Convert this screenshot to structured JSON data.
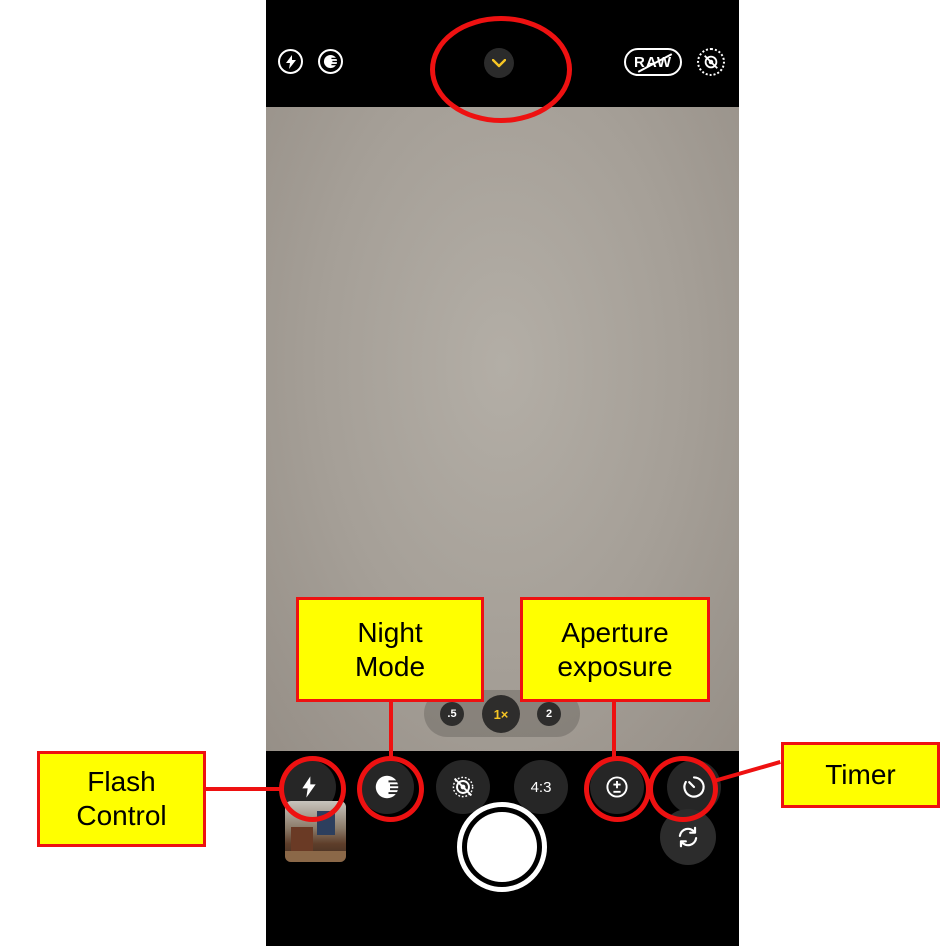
{
  "camera": {
    "top_bar": {
      "raw_label": "RAW",
      "icons": [
        "flash-icon",
        "night-mode-icon",
        "chevron-down-icon",
        "raw-icon",
        "live-photo-off-icon"
      ]
    },
    "zoom": {
      "options": [
        ".5",
        "1×",
        "2"
      ],
      "selected": "1×"
    },
    "controls_row": {
      "aspect_label": "4:3",
      "icons": [
        "flash-icon",
        "night-mode-icon",
        "live-photo-off-icon",
        "aspect-ratio",
        "exposure-icon",
        "timer-icon"
      ]
    },
    "bottom": {
      "icons": [
        "photo-thumbnail",
        "shutter-button",
        "camera-flip-icon"
      ]
    },
    "colors": {
      "accent": "#f7c624",
      "annotation_red": "#e11111",
      "label_yellow": "#ffff00"
    }
  },
  "annotations": {
    "night_mode": [
      "Night",
      "Mode"
    ],
    "aperture_exposure": [
      "Aperture",
      "exposure"
    ],
    "flash_control": [
      "Flash",
      "Control"
    ],
    "timer": "Timer"
  }
}
